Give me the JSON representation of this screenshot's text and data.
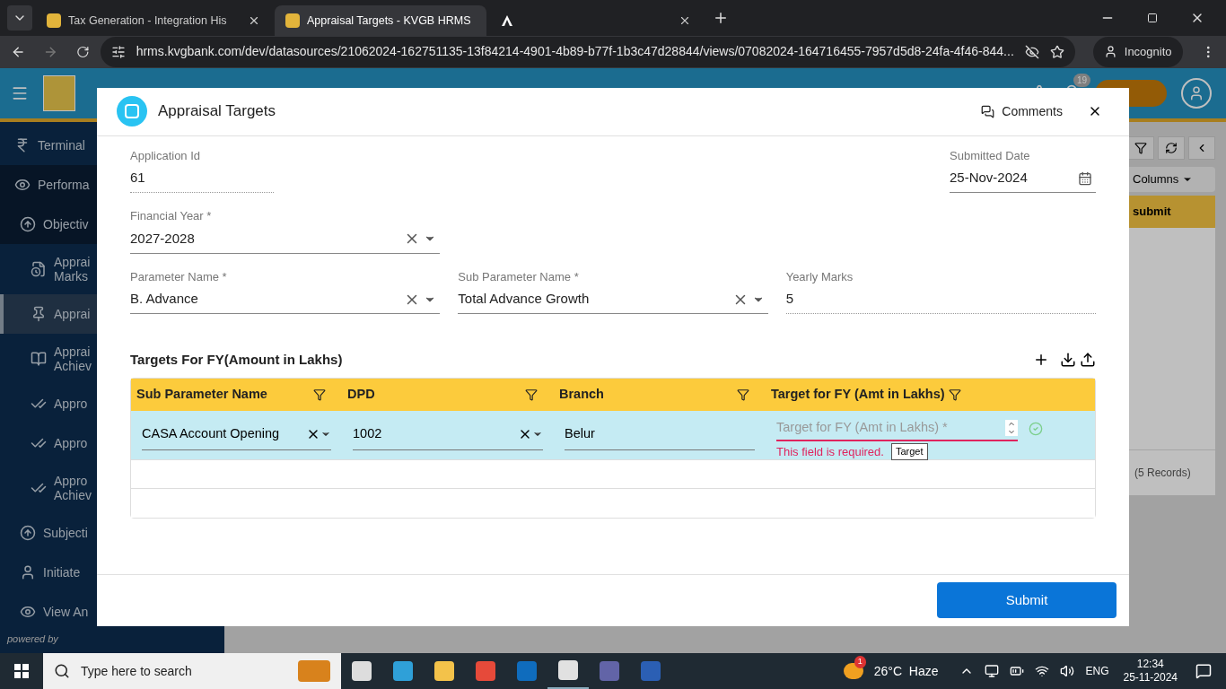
{
  "browser": {
    "tabs": [
      {
        "title": "Tax Generation - Integration His",
        "selected": false
      },
      {
        "title": "Appraisal Targets - KVGB HRMS",
        "selected": true
      },
      {
        "selected": false
      }
    ],
    "url": "hrms.kvgbank.com/dev/datasources/21062024-162751135-13f84214-4901-4b89-b77f-1b3c47d28844/views/07082024-164716455-7957d5d8-24fa-4f46-844...",
    "profile": "Incognito"
  },
  "header": {
    "notification_count": "19"
  },
  "sidebar": {
    "items": [
      {
        "label": "Terminal",
        "selected": false
      },
      {
        "label": "Performa",
        "selected": false,
        "expanded": true,
        "children": [
          {
            "label": "Objectiv",
            "selected": false,
            "expanded": true,
            "children": [
              {
                "label": "Apprai\nMarks",
                "selected": false
              },
              {
                "label": "Apprai",
                "selected": true
              },
              {
                "label": "Apprai\nAchiev",
                "selected": false
              },
              {
                "label": "Appro",
                "selected": false
              },
              {
                "label": "Appro",
                "selected": false
              },
              {
                "label": "Appro\nAchiev",
                "selected": false
              }
            ]
          },
          {
            "label": "Subjecti",
            "selected": false
          },
          {
            "label": "Initiate",
            "selected": false
          },
          {
            "label": "View An",
            "selected": false
          }
        ]
      }
    ],
    "footer": "powered by"
  },
  "background_grid": {
    "columns_button": "Columns",
    "column_heading": "submit",
    "record_count": "(5 Records)"
  },
  "dialog": {
    "title": "Appraisal Targets",
    "comments": "Comments",
    "fields": {
      "application_id": {
        "label": "Application Id",
        "value": "61"
      },
      "submitted_date": {
        "label": "Submitted Date",
        "value": "25-Nov-2024"
      },
      "financial_year": {
        "label": "Financial Year *",
        "value": "2027-2028"
      },
      "parameter_name": {
        "label": "Parameter Name *",
        "value": "B. Advance"
      },
      "sub_parameter_name": {
        "label": "Sub Parameter Name *",
        "value": "Total Advance Growth"
      },
      "yearly_marks": {
        "label": "Yearly Marks",
        "value": "5"
      }
    },
    "targets": {
      "title": "Targets For FY(Amount in Lakhs)",
      "columns": [
        "Sub Parameter Name",
        "DPD",
        "Branch",
        "Target for FY (Amt in Lakhs)"
      ],
      "rows": [
        {
          "selected": true,
          "sub_parameter_name": "CASA Account Opening",
          "dpd": "1002",
          "branch": "Belur",
          "target_placeholder": "Target for FY (Amt in Lakhs) *",
          "error": "This field is required.",
          "tooltip": "Target"
        }
      ]
    },
    "submit": "Submit"
  },
  "taskbar": {
    "search_placeholder": "Type here to search",
    "weather_badge": "1",
    "weather": "26°C  Haze",
    "language": "ENG",
    "time": "12:34",
    "date": "25-11-2024"
  }
}
